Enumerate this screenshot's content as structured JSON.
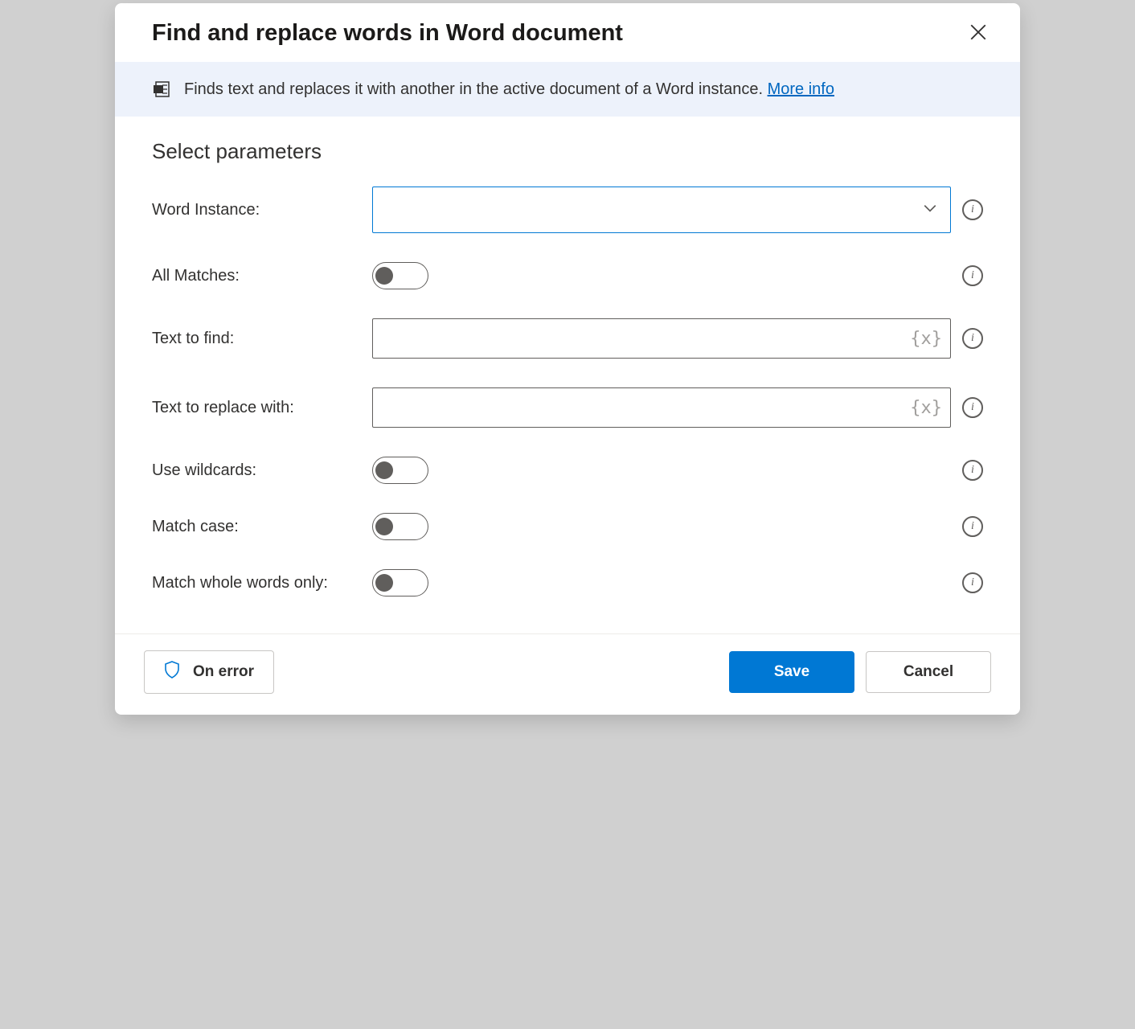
{
  "header": {
    "title": "Find and replace words in Word document"
  },
  "info": {
    "text": "Finds text and replaces it with another in the active document of a Word instance. ",
    "link_label": "More info"
  },
  "section": {
    "title": "Select parameters"
  },
  "fields": {
    "word_instance": {
      "label": "Word Instance:",
      "value": ""
    },
    "all_matches": {
      "label": "All Matches:",
      "value": false
    },
    "text_to_find": {
      "label": "Text to find:",
      "value": ""
    },
    "text_to_replace": {
      "label": "Text to replace with:",
      "value": ""
    },
    "use_wildcards": {
      "label": "Use wildcards:",
      "value": false
    },
    "match_case": {
      "label": "Match case:",
      "value": false
    },
    "match_whole_words": {
      "label": "Match whole words only:",
      "value": false
    }
  },
  "footer": {
    "on_error": "On error",
    "save": "Save",
    "cancel": "Cancel"
  }
}
